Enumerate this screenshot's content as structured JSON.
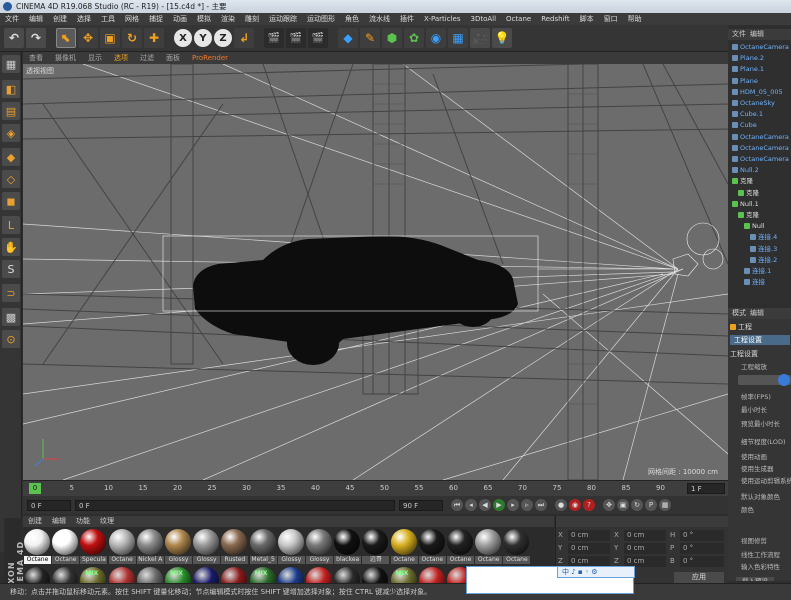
{
  "window": {
    "title": "CINEMA 4D R19.068 Studio (RC - R19) - [15.c4d *] - 主要"
  },
  "menu": [
    "文件",
    "编辑",
    "创建",
    "选择",
    "工具",
    "网格",
    "捕捉",
    "动画",
    "模拟",
    "渲染",
    "雕刻",
    "运动跟踪",
    "运动图形",
    "角色",
    "流水线",
    "插件",
    "X-Particles",
    "3DtoAll",
    "Octane",
    "Redshift",
    "脚本",
    "窗口",
    "帮助"
  ],
  "toolbar": {
    "undo": "↶",
    "move": "✥",
    "scale": "▣",
    "rotate": "↻",
    "add": "✚",
    "x": "X",
    "y": "Y",
    "z": "Z",
    "coord": "↲"
  },
  "viewport": {
    "menus": [
      "查看",
      "摄像机",
      "显示",
      "选项",
      "过滤",
      "面板",
      "ProRender"
    ],
    "label": "透视视图",
    "grid_info": "网格间距 : 10000 cm"
  },
  "timeline": {
    "ticks": [
      "0",
      "5",
      "10",
      "15",
      "20",
      "25",
      "30",
      "35",
      "40",
      "45",
      "50",
      "55",
      "60",
      "65",
      "70",
      "75",
      "80",
      "85",
      "90"
    ],
    "current_frame": "0 F",
    "end_label": "1 F",
    "start_field": "0 F",
    "min_field": "0 F",
    "max_field": "90 F",
    "end_field": "90 F"
  },
  "materials": {
    "menus": [
      "创建",
      "编辑",
      "功能",
      "纹理"
    ],
    "row1": [
      {
        "label": "Octane",
        "color": "#f2f2f2"
      },
      {
        "label": "Octane",
        "color": "#ffffff"
      },
      {
        "label": "Specula",
        "color": "#c01010"
      },
      {
        "label": "Octane",
        "color": "#b8b8b8"
      },
      {
        "label": "Nickel A",
        "color": "#8c8c8c"
      },
      {
        "label": "Glossy",
        "color": "#b08850"
      },
      {
        "label": "Glossy",
        "color": "#9a9a9a"
      },
      {
        "label": "Rusted",
        "color": "#8a6a50"
      },
      {
        "label": "Metal_5",
        "color": "#6a6a6a"
      },
      {
        "label": "Glossy",
        "color": "#c8c8c8"
      },
      {
        "label": "Glossy",
        "color": "#7a7a7a"
      },
      {
        "label": "blackea",
        "color": "#111111"
      },
      {
        "label": "远哥",
        "color": "#1a1a1a"
      },
      {
        "label": "Octane",
        "color": "#d8b020"
      },
      {
        "label": "Octane",
        "color": "#1a1a1a"
      },
      {
        "label": "Octane",
        "color": "#222222"
      },
      {
        "label": "Octane",
        "color": "#a0a0a0"
      },
      {
        "label": "Octane",
        "color": "#303030"
      }
    ],
    "row2_colors": [
      "#222",
      "#303030",
      "#6a6a2a",
      "#b03030",
      "#6a6a6a",
      "#2a8a2a",
      "#1a1a6a",
      "#8a1a1a",
      "#2a6a2a",
      "#1a3a8a",
      "#c02020",
      "#2a2a2a",
      "#111",
      "#6a6a2a",
      "#c02020",
      "#c02020",
      "#1a1a1a",
      "#3a3a3a"
    ],
    "mix_label": "MIX"
  },
  "maxon_logo": "MAXON CINEMA 4D",
  "coords": {
    "labels": [
      "X",
      "Y",
      "Z"
    ],
    "pos": [
      "0 cm",
      "0 cm",
      "0 cm"
    ],
    "size": [
      "0 cm",
      "0 cm",
      "0 cm"
    ],
    "rot_labels": [
      "H",
      "P",
      "B"
    ],
    "rot": [
      "0 °",
      "0 °",
      "0 °"
    ],
    "apply": "应用"
  },
  "objects": {
    "menus": [
      "文件",
      "编辑"
    ],
    "items": [
      {
        "label": "OctaneCamera",
        "cls": "",
        "x": 4
      },
      {
        "label": "Plane.2",
        "cls": "",
        "x": 4
      },
      {
        "label": "Plane.1",
        "cls": "",
        "x": 4
      },
      {
        "label": "Plane",
        "cls": "",
        "x": 4
      },
      {
        "label": "HDM_05_005",
        "cls": "",
        "x": 4
      },
      {
        "label": "OctaneSky",
        "cls": "",
        "x": 4
      },
      {
        "label": "Cube.1",
        "cls": "",
        "x": 4
      },
      {
        "label": "Cube",
        "cls": "",
        "x": 4
      },
      {
        "label": "OctaneCamera",
        "cls": "",
        "x": 4
      },
      {
        "label": "OctaneCamera",
        "cls": "",
        "x": 4
      },
      {
        "label": "OctaneCamera",
        "cls": "",
        "x": 4
      },
      {
        "label": "Null.2",
        "cls": "",
        "x": 4
      },
      {
        "label": "克隆",
        "cls": "w",
        "x": 4
      },
      {
        "label": "克隆",
        "cls": "w",
        "x": 10
      },
      {
        "label": "Null.1",
        "cls": "w",
        "x": 4
      },
      {
        "label": "克隆",
        "cls": "w",
        "x": 10
      },
      {
        "label": "Null",
        "cls": "w",
        "x": 16
      },
      {
        "label": "连接.4",
        "cls": "",
        "x": 22
      },
      {
        "label": "连接.3",
        "cls": "",
        "x": 22
      },
      {
        "label": "连接.2",
        "cls": "",
        "x": 22
      },
      {
        "label": "连接.1",
        "cls": "",
        "x": 16
      },
      {
        "label": "连接",
        "cls": "",
        "x": 16
      }
    ]
  },
  "attributes": {
    "menus": [
      "模式",
      "编辑"
    ],
    "object_label": "工程",
    "tab": "工程设置",
    "section": "工程设置",
    "rows": [
      "工程缩放",
      "帧率(FPS)",
      "最小时长",
      "预览最小时长",
      "细节程度(LOD)",
      "使用动画",
      "使用生成器",
      "使用运动剪辑系统",
      "默认对象颜色",
      "颜色",
      "",
      "视图修剪",
      "线性工作流程",
      "输入色彩特性",
      "载入预设"
    ]
  },
  "statusbar": "移动：点击并拖动鼠标移动元素。按住 SHIFT 键量化移动；节点编辑模式时按住 SHIFT 键增加选择对象；按住 CTRL 键减少选择对象。",
  "ime": {
    "label": "中"
  }
}
